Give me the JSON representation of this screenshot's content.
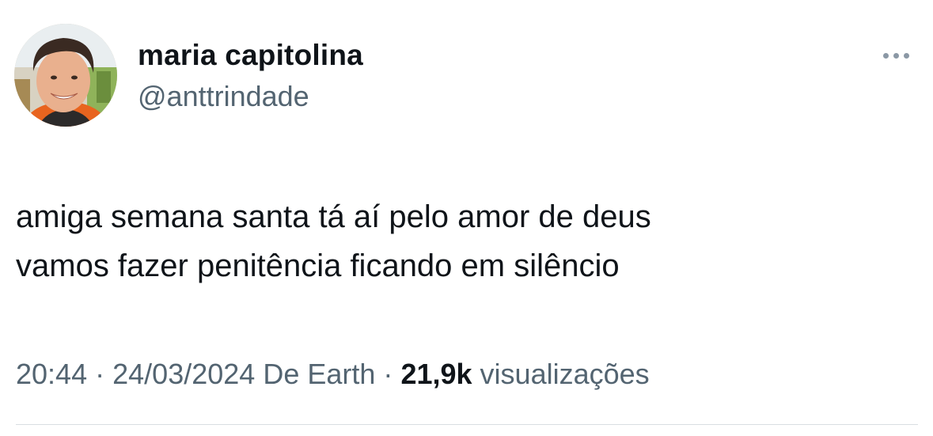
{
  "tweet": {
    "author": {
      "display_name": "maria capitolina",
      "handle": "@anttrindade"
    },
    "text_lines": [
      "amiga semana santa tá aí pelo amor de deus",
      "vamos fazer penitência ficando em silêncio"
    ],
    "meta": {
      "time": "20:44",
      "separator": "·",
      "date": "24/03/2024",
      "source": "De Earth",
      "views_count": "21,9k",
      "views_label": "visualizações"
    },
    "more_icon": "more-horizontal-icon"
  },
  "colors": {
    "text_primary": "#0f1419",
    "text_secondary": "#536471",
    "divider": "#d9dee2",
    "more_dots": "#8b98a5"
  }
}
